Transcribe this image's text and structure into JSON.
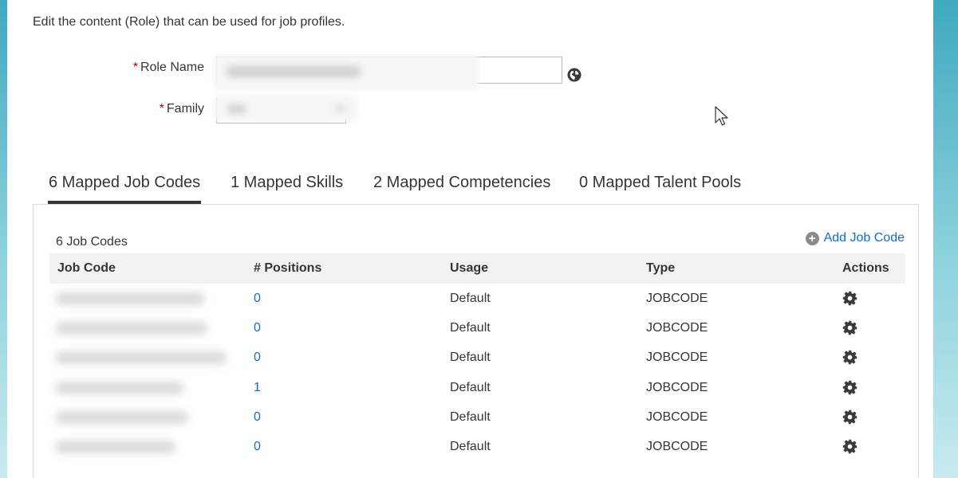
{
  "intro_text": "Edit the content (Role) that can be used for job profiles.",
  "form": {
    "required_mark": "*",
    "role_name_label": "Role Name",
    "family_label": "Family"
  },
  "tabs": [
    {
      "label": "6 Mapped Job Codes",
      "active": true
    },
    {
      "label": "1 Mapped Skills",
      "active": false
    },
    {
      "label": "2 Mapped Competencies",
      "active": false
    },
    {
      "label": "0 Mapped Talent Pools",
      "active": false
    }
  ],
  "job_codes": {
    "count_label": "6 Job Codes",
    "add_label": "Add Job Code",
    "columns": [
      "Job Code",
      "# Positions",
      "Usage",
      "Type",
      "Actions"
    ],
    "rows": [
      {
        "positions": "0",
        "usage": "Default",
        "type": "JOBCODE"
      },
      {
        "positions": "0",
        "usage": "Default",
        "type": "JOBCODE"
      },
      {
        "positions": "0",
        "usage": "Default",
        "type": "JOBCODE"
      },
      {
        "positions": "1",
        "usage": "Default",
        "type": "JOBCODE"
      },
      {
        "positions": "0",
        "usage": "Default",
        "type": "JOBCODE"
      },
      {
        "positions": "0",
        "usage": "Default",
        "type": "JOBCODE"
      }
    ]
  },
  "colors": {
    "link": "#0a6ed1",
    "required": "#bb0000",
    "text": "#32363a",
    "header_bg": "#f2f2f2"
  },
  "icons": {
    "translate": "globe-icon",
    "add": "add-circle-icon",
    "row_action": "gear-icon",
    "pointer": "mouse-cursor-icon"
  }
}
